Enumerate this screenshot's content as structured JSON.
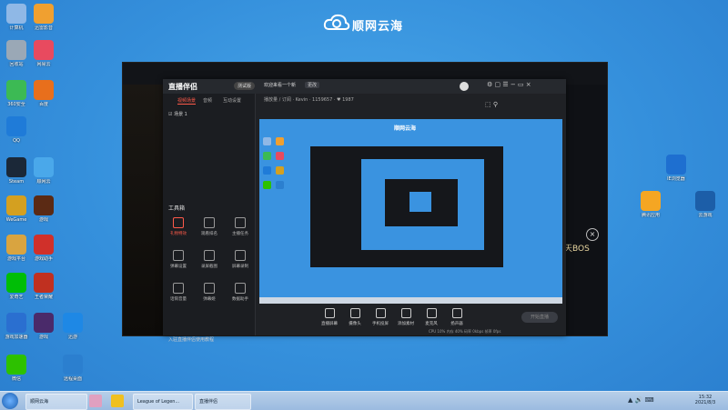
{
  "brand": {
    "text": "顺网云海"
  },
  "desktop_icons": [
    {
      "label": "计算机",
      "color": "#8fb8e6"
    },
    {
      "label": "迅雷影音",
      "color": "#f0a030"
    },
    {
      "label": "回收站",
      "color": "#9aa8b6"
    },
    {
      "label": "网易云",
      "color": "#e84a5f"
    },
    {
      "label": "360安全",
      "color": "#3cba54"
    },
    {
      "label": "百度",
      "color": "#e86f1c"
    },
    {
      "label": "QQ",
      "color": "#1f7bd8"
    },
    {
      "label": "Steam",
      "color": "#1b2838"
    },
    {
      "label": "顺网云",
      "color": "#4aa8ea"
    },
    {
      "label": "WeGame",
      "color": "#d4a020"
    },
    {
      "label": "游戏",
      "color": "#5b2a14"
    },
    {
      "label": "游戏平台",
      "color": "#d9a440"
    },
    {
      "label": "游戏助手",
      "color": "#d0302a"
    },
    {
      "label": "爱奇艺",
      "color": "#00be06"
    },
    {
      "label": "王者荣耀",
      "color": "#c03020"
    },
    {
      "label": "游戏加速器",
      "color": "#2a6fd0"
    },
    {
      "label": "游戏",
      "color": "#4a2a6a"
    },
    {
      "label": "迅游",
      "color": "#1e88e5"
    },
    {
      "label": "微信",
      "color": "#2dc100"
    },
    {
      "label": "远程桌面",
      "color": "#2b7fcf"
    },
    {
      "label": "IE浏览器",
      "color": "#1e6fd0"
    },
    {
      "label": "腾讯应用",
      "color": "#f5a623"
    },
    {
      "label": "云游戏",
      "color": "#1c5ea8"
    }
  ],
  "game_window": {
    "boss_text": "天BOS",
    "close_label": "×"
  },
  "app": {
    "logo": "直播伴侣",
    "badge": "测试版",
    "controls": "⚙ ▢ ☰ − ▭ ×",
    "tabs": [
      "视频场景",
      "音频",
      "互动设置"
    ],
    "scene": "☑ 场景 1",
    "tools_title": "工具箱",
    "tools": [
      {
        "label": "礼物特效",
        "red": true
      },
      {
        "label": "观看排名",
        "red": false
      },
      {
        "label": "主播任务",
        "red": false
      },
      {
        "label": "弹幕设置",
        "red": false
      },
      {
        "label": "录屏截图",
        "red": false
      },
      {
        "label": "屏幕录制",
        "red": false
      },
      {
        "label": "话筒音量",
        "red": false
      },
      {
        "label": "弹幕姬",
        "red": false
      },
      {
        "label": "数据助手",
        "red": false
      }
    ],
    "status": "入驻直播伴侣使用教程",
    "room_title": "欢迎来看一个新",
    "room_tag": "更改",
    "room_meta": "播放量 / 订阅  ·  Kevin  ·  1159657  ·  ♥ 1987",
    "room_icons": "⬚  ⚲",
    "preview_brand": "顺网云海",
    "bottom_buttons": [
      "直播屏幕",
      "摄像头",
      "手机投屏",
      "添加素材",
      "麦克风",
      "扬声器"
    ],
    "start_live": "开始直播",
    "bottom_meta": "CPU 10%  内存 40%  码率 0kbps  帧率 0fps"
  },
  "taskbar": {
    "items": [
      {
        "label": "顺网云海"
      },
      {
        "label": "League of Legen..."
      },
      {
        "label": "直播伴侣"
      }
    ],
    "tray": "▲ 🔊 ⌨",
    "time": "15:32",
    "date": "2021/8/3"
  }
}
